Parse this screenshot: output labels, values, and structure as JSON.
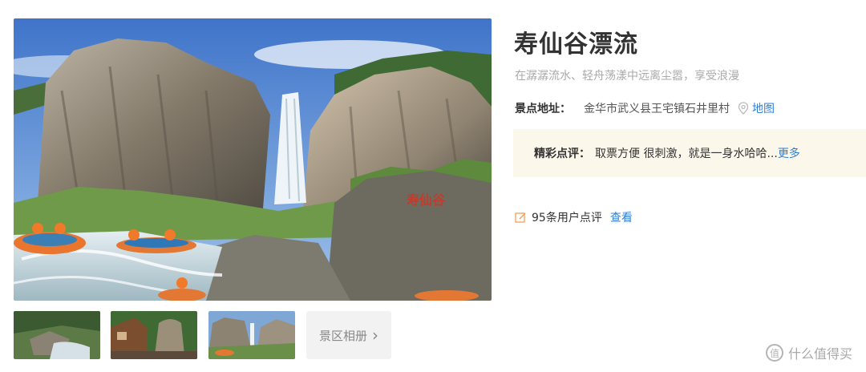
{
  "attraction": {
    "title": "寿仙谷漂流",
    "subtitle": "在潺潺流水、轻舟荡漾中远离尘嚣，享受浪漫",
    "address_label": "景点地址：",
    "address_value": "金华市武义县王宅镇石井里村",
    "map_label": "地图",
    "review_label": "精彩点评：",
    "review_text": "取票方便 很刺激，就是一身水哈哈...",
    "more_label": "更多",
    "review_count": "95条用户点评",
    "view_label": "查看",
    "rock_text": "寿仙谷"
  },
  "gallery": {
    "album_label": "景区相册",
    "album_arrow": "›"
  },
  "watermark": {
    "badge": "值",
    "text": "什么值得买"
  },
  "icons": {
    "map": "location-pin-icon",
    "review_count": "edit-icon",
    "album_arrow": "chevron-right-icon"
  }
}
